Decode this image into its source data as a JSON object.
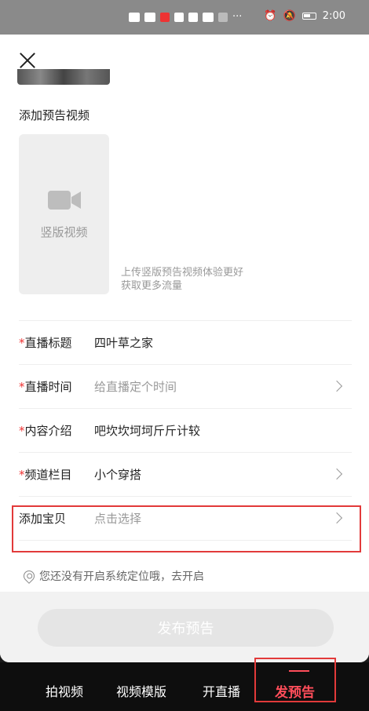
{
  "status_bar": {
    "time": "2:00",
    "left_icons": [
      "hd-icon",
      "signal-icon",
      "app-icon",
      "wechat-icon",
      "app-icon",
      "app-icon",
      "wifi-icon"
    ],
    "more": "···",
    "right_icons": [
      "alarm-icon",
      "mute-icon",
      "battery-icon"
    ]
  },
  "sheet": {
    "section_title": "添加预告视频",
    "video_box_label": "竖版视频",
    "upload_hint_line1": "上传竖版预告视频体验更好",
    "upload_hint_line2": "获取更多流量"
  },
  "form": {
    "required_mark": "*",
    "rows": [
      {
        "label": "直播标题",
        "value": "四叶草之家",
        "required": true,
        "placeholder": false
      },
      {
        "label": "直播时间",
        "value": "给直播定个时间",
        "required": true,
        "placeholder": true
      },
      {
        "label": "内容介绍",
        "value": "吧坎坎坷坷斤斤计较",
        "required": true,
        "placeholder": false
      },
      {
        "label": "频道栏目",
        "value": "小个穿搭",
        "required": true,
        "placeholder": false
      },
      {
        "label": "添加宝贝",
        "value": "点击选择",
        "required": false,
        "placeholder": true
      }
    ]
  },
  "location_hint": "您还没有开启系统定位哦，去开启",
  "publish_button": "发布预告",
  "tabs": [
    {
      "label": "拍视频",
      "active": false
    },
    {
      "label": "视频模版",
      "active": false
    },
    {
      "label": "开直播",
      "active": false
    },
    {
      "label": "发预告",
      "active": true
    }
  ],
  "colors": {
    "accent": "#ff4d5a",
    "required": "#e33333",
    "highlight_box": "#e23a3a",
    "status_bar": "#8a8a8a"
  }
}
